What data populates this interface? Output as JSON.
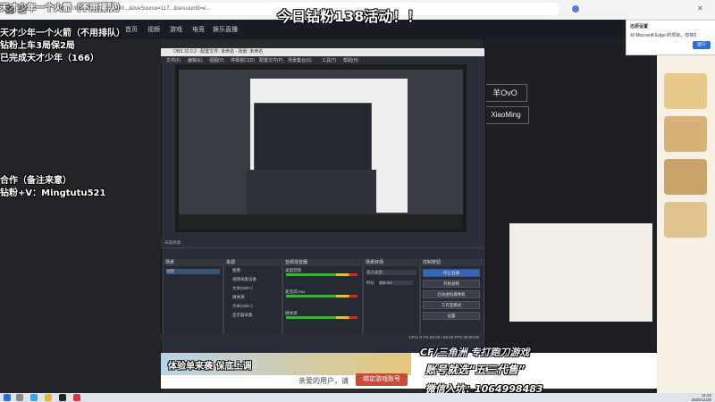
{
  "browser": {
    "address": "https://live.../?spm_id=2140...&liveSource=117...&sessionId=e..."
  },
  "site_nav": [
    "首页",
    "视频",
    "游戏",
    "电竞",
    "娱乐直播"
  ],
  "overlay": {
    "headline": "今日钻粉138活动！！",
    "top_faded": "天才少年一个火箭（不用排队）",
    "lines": [
      "天才少年一个火箭（不用排队）",
      "钻粉上车3局保2局",
      "已完成天才少年（166）"
    ],
    "collab": "合作（备注来意）",
    "wechat": "钻粉+V：Mingtutu521"
  },
  "page_right": {
    "button1": "羊OvO",
    "button2": "XiaoMing"
  },
  "edge_popup": {
    "title": "还原设置",
    "body": "对 Microsoft Edge 的项目，你将在打开应用...",
    "button": "运行"
  },
  "obs": {
    "title": "OBS 32.0.2 - 配置文件: 未命名 - 场景: 未命名",
    "menu": [
      "文件(F)",
      "编辑(E)",
      "视图(V)",
      "停靠窗口(D)",
      "配置文件(P)",
      "场景集合(S)",
      "工具(T)",
      "帮助(H)"
    ],
    "toolbar_label": "未选择源",
    "docks": {
      "scenes": {
        "title": "场景",
        "items": [
          "场景"
        ]
      },
      "sources": {
        "title": "来源",
        "items": [
          "图像",
          "视频采集设备",
          "文本(GDI+)",
          "媒体源",
          "文本(GDI+)",
          "显示器采集"
        ]
      },
      "mixer": {
        "title": "音频混音器",
        "channels": [
          "桌面音频",
          "麦克风/Aux",
          "媒体源"
        ]
      },
      "transitions": {
        "title": "场景转场",
        "type": "淡入淡出",
        "duration_label": "时长",
        "duration": "300 ms"
      },
      "controls": {
        "title": "控制按钮",
        "buttons": [
          "停止直播",
          "开始录制",
          "启动虚拟摄像机",
          "工作室模式",
          "设置"
        ]
      }
    },
    "status": "CPU: 0.7%   60.00 / 60.00 FPS   00:00:00"
  },
  "stream_overlay": {
    "cf": "CF/三角洲 专打跑刀游戏",
    "account": "账号就选“五三代售”",
    "group": "微信入坑：1064998483"
  },
  "bottom": {
    "banner": "体验单来袭 保底上调",
    "login_text": "亲爱的用户，请",
    "login_button": "绑定游戏账号"
  },
  "taskbar": {
    "time": "11:02",
    "date": "2025/11/29"
  }
}
